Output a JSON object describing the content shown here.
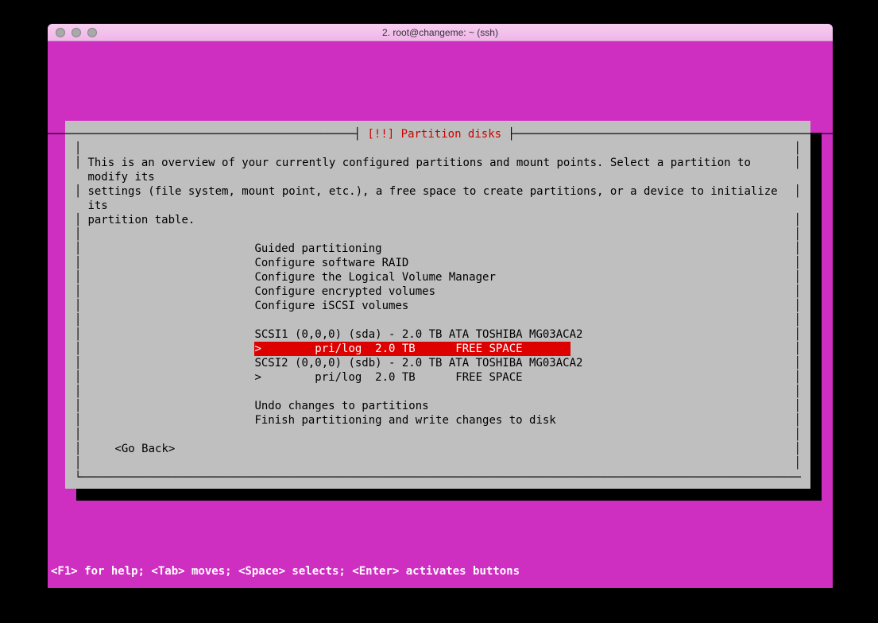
{
  "window": {
    "title": "2. root@changeme: ~ (ssh)"
  },
  "dialog": {
    "title_label": "[!!] Partition disks",
    "description_lines": [
      "This is an overview of your currently configured partitions and mount points. Select a partition to modify its",
      "settings (file system, mount point, etc.), a free space to create partitions, or a device to initialize its",
      "partition table."
    ],
    "menu_top": [
      "Guided partitioning",
      "Configure software RAID",
      "Configure the Logical Volume Manager",
      "Configure encrypted volumes",
      "Configure iSCSI volumes"
    ],
    "disks": {
      "disk1_header": "SCSI1 (0,0,0) (sda) - 2.0 TB ATA TOSHIBA MG03ACA2",
      "disk1_part": ">        pri/log  2.0 TB      FREE SPACE",
      "disk2_header": "SCSI2 (0,0,0) (sdb) - 2.0 TB ATA TOSHIBA MG03ACA2",
      "disk2_part": ">        pri/log  2.0 TB      FREE SPACE"
    },
    "menu_bottom": [
      "Undo changes to partitions",
      "Finish partitioning and write changes to disk"
    ],
    "go_back": "<Go Back>"
  },
  "helpbar": "<F1> for help; <Tab> moves; <Space> selects; <Enter> activates buttons"
}
